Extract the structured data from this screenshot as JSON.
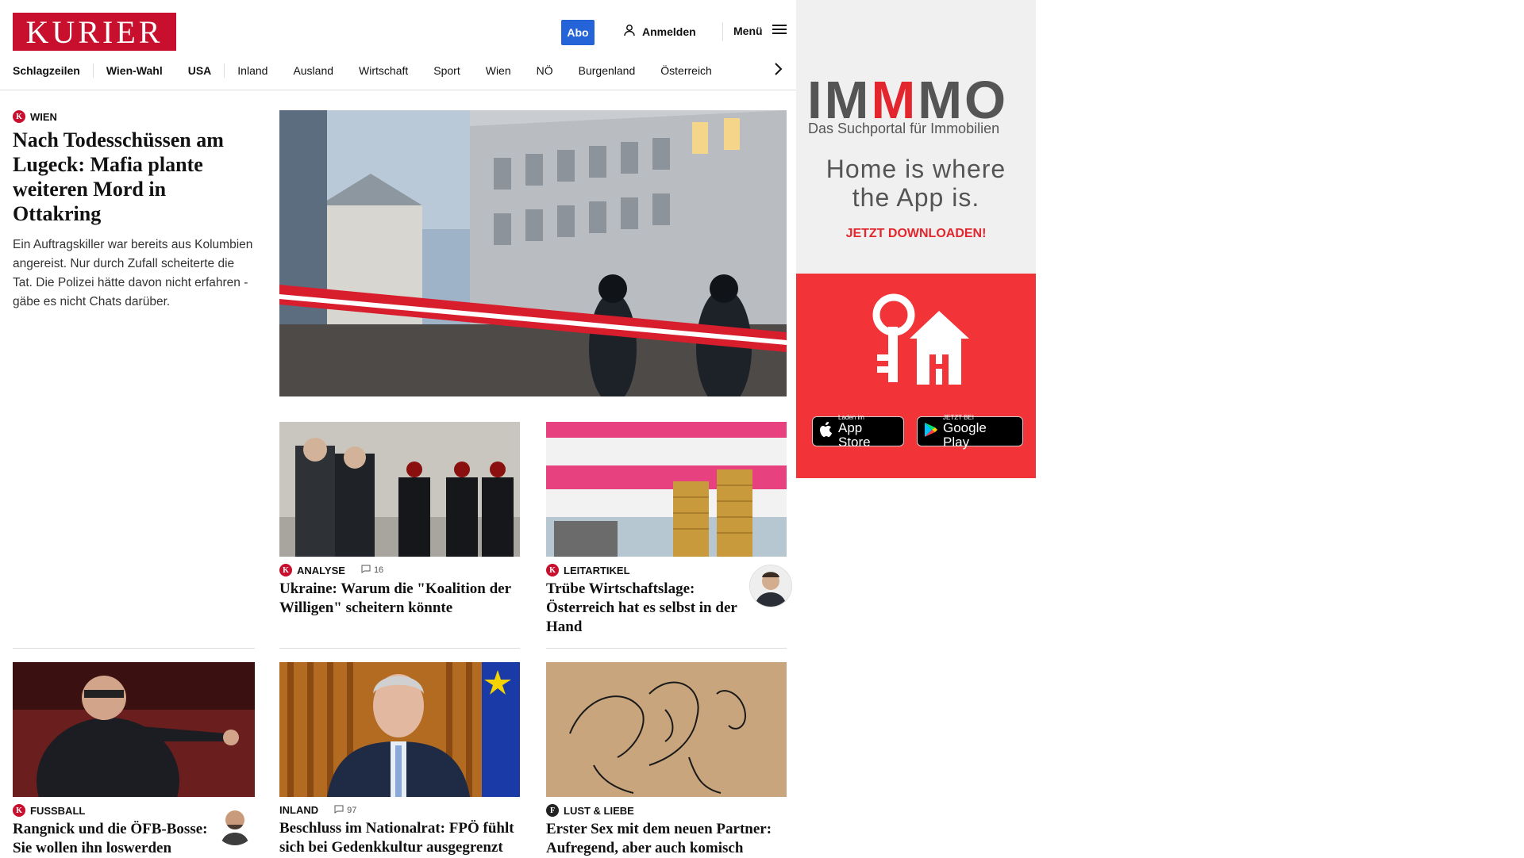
{
  "brand": {
    "logo_text": "KURIER",
    "accent": "#c8102e"
  },
  "header": {
    "abo_label": "Abo",
    "login_label": "Anmelden",
    "menu_label": "Menü"
  },
  "nav": {
    "items": [
      "Schlagzeilen",
      "Wien-Wahl",
      "USA",
      "Inland",
      "Ausland",
      "Wirtschaft",
      "Sport",
      "Wien",
      "NÖ",
      "Burgenland",
      "Österreich"
    ]
  },
  "lead": {
    "kicker": "WIEN",
    "title": "Nach Todesschüssen am Lugeck: Mafia plante weiteren Mord in Ottakring",
    "teaser": "Ein Auftragskiller war bereits aus Kolumbien angereist. Nur durch Zufall scheiterte die Tat. Die Polizei hätte davon nicht erfahren - gäbe es nicht Chats darüber."
  },
  "cards": [
    {
      "kicker": "ANALYSE",
      "comments": "16",
      "title": "Ukraine: Warum die \"Koalition der Willigen\" scheitern könnte"
    },
    {
      "kicker": "LEITARTIKEL",
      "title": "Trübe Wirtschaftslage: Österreich hat es selbst in der Hand"
    },
    {
      "kicker": "FUSSBALL",
      "title": "Rangnick und die ÖFB-Bosse: Sie wollen ihn loswerden"
    },
    {
      "kicker": "INLAND",
      "comments": "97",
      "title": "Beschluss im Nationalrat: FPÖ fühlt sich bei Gedenkkultur ausgegrenzt"
    },
    {
      "kicker": "LUST & LIEBE",
      "title": "Erster Sex mit dem neuen Partner: Aufregend, aber auch komisch"
    }
  ],
  "ad": {
    "logo_im": "IM",
    "logo_m": "M",
    "logo_mo": "MO",
    "subtitle": "Das Suchportal für Immobilien",
    "headline_1": "Home is where",
    "headline_2": "the App is.",
    "cta": "JETZT DOWNLOADEN!",
    "appstore_small": "Laden im",
    "appstore_big": "App Store",
    "gplay_small": "JETZT BEI",
    "gplay_big": "Google Play",
    "colors": {
      "red": "#f23439",
      "grey": "#555555"
    }
  }
}
